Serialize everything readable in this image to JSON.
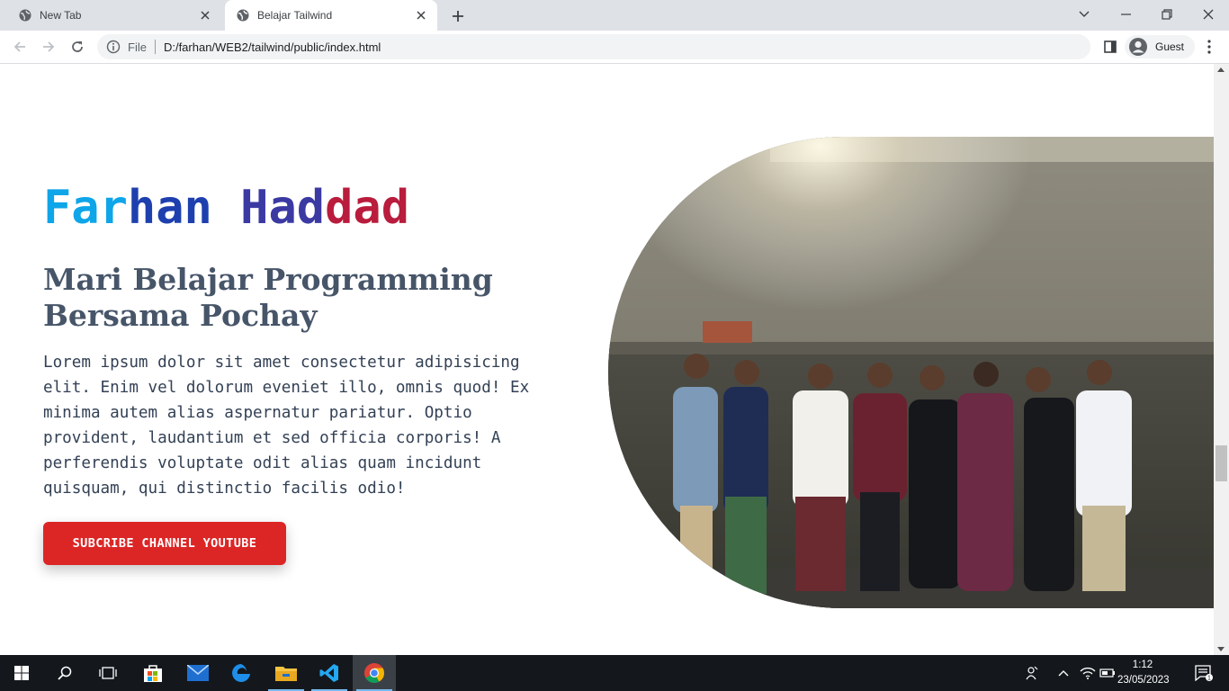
{
  "browser": {
    "tabs": [
      {
        "title": "New Tab",
        "active": false
      },
      {
        "title": "Belajar Tailwind",
        "active": true
      }
    ],
    "scheme_label": "File",
    "url": "D:/farhan/WEB2/tailwind/public/index.html",
    "profile_label": "Guest"
  },
  "hero": {
    "name_part1": "Far",
    "name_part2": "han",
    "name_part3": "Had",
    "name_part4": "dad",
    "subtitle": "Mari Belajar Programming Bersama Pochay",
    "description": "Lorem ipsum dolor sit amet consectetur adipisicing elit. Enim vel dolorum eveniet illo, omnis quod! Ex minima autem alias aspernatur pariatur. Optio provident, laudantium et sed officia corporis! A perferendis voluptate odit alias quam incidunt quisquam, qui distinctio facilis odio!",
    "cta_label": "SUBCRIBE CHANNEL YOUTUBE",
    "name_gradient": [
      "#0ea5e9",
      "#1e40af",
      "#6d28d9",
      "#dc2626"
    ],
    "cta_color": "#dc2626"
  },
  "taskbar": {
    "apps": [
      "start",
      "search",
      "task-view",
      "store",
      "mail",
      "edge",
      "file-explorer",
      "vscode",
      "chrome"
    ],
    "time": "1:12",
    "date": "23/05/2023",
    "notification_count": "1"
  }
}
